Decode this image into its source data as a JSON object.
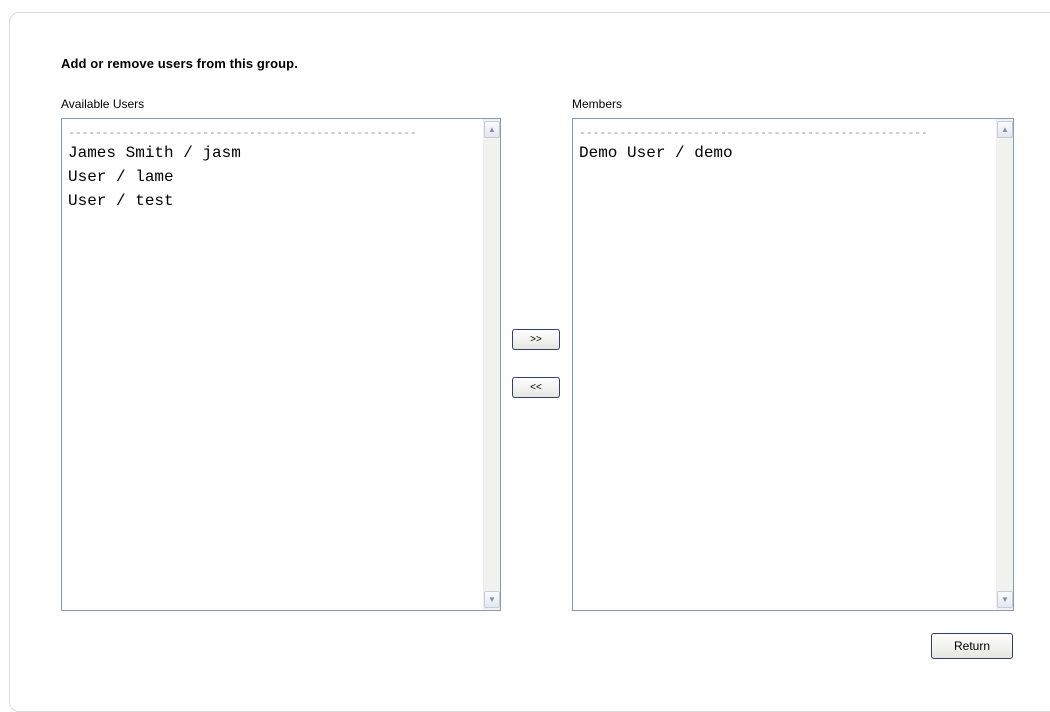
{
  "heading": "Add or remove users from this group.",
  "available": {
    "label": "Available Users",
    "separator": "----------------------------------------------------",
    "items": [
      "James Smith / jasm",
      "User / lame",
      "User / test"
    ]
  },
  "members": {
    "label": "Members",
    "separator": "----------------------------------------------------",
    "items": [
      "Demo User / demo"
    ]
  },
  "buttons": {
    "add": ">>",
    "remove": "<<",
    "return": "Return"
  },
  "icons": {
    "scroll_up": "scroll-up-arrow-icon",
    "scroll_down": "scroll-down-arrow-icon"
  }
}
